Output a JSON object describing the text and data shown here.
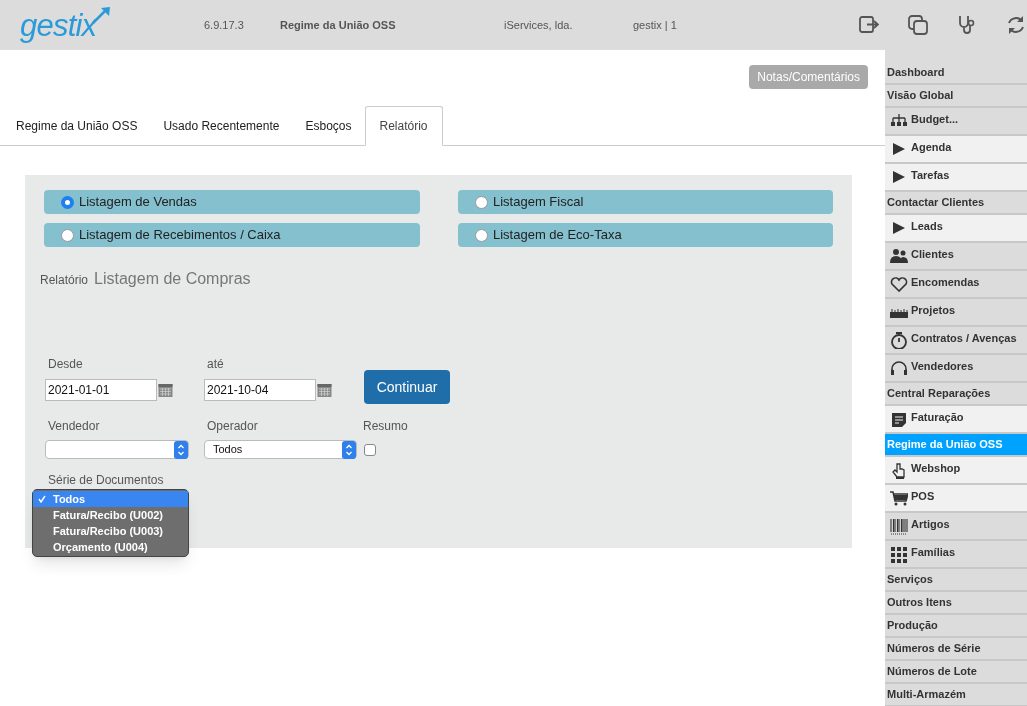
{
  "header": {
    "logo": "gestix",
    "version": "6.9.17.3",
    "module": "Regime da União OSS",
    "company": "iServices, lda.",
    "user": "gestix | 1"
  },
  "notes_button": "Notas/Comentários",
  "tabs": [
    {
      "label": "Regime da União OSS",
      "selected": false
    },
    {
      "label": "Usado Recentemente",
      "selected": false
    },
    {
      "label": "Esboços",
      "selected": false
    },
    {
      "label": "Relatório",
      "selected": true
    }
  ],
  "report_types": [
    {
      "label": "Listagem de Vendas",
      "selected": true
    },
    {
      "label": "Listagem Fiscal",
      "selected": false
    },
    {
      "label": "Listagem de Recebimentos / Caixa",
      "selected": false
    },
    {
      "label": "Listagem de Eco-Taxa",
      "selected": false
    }
  ],
  "report": {
    "label": "Relatório",
    "title": "Listagem de Compras"
  },
  "form": {
    "from_label": "Desde",
    "from_value": "2021-01-01",
    "to_label": "até",
    "to_value": "2021-10-04",
    "continue_button": "Continuar",
    "seller_label": "Vendedor",
    "operator_label": "Operador",
    "operator_value": "Todos",
    "summary_label": "Resumo",
    "summary_checked": false,
    "series_label": "Série de Documentos",
    "series_options": [
      {
        "label": "Todos",
        "selected": true
      },
      {
        "label": "Fatura/Recibo (U002)",
        "selected": false
      },
      {
        "label": "Fatura/Recibo (U003)",
        "selected": false
      },
      {
        "label": "Orçamento (U004)",
        "selected": false
      }
    ]
  },
  "sidebar": {
    "items": [
      {
        "label": "Dashboard",
        "kind": "text",
        "highlighted": false,
        "selected": false
      },
      {
        "label": "Visão Global",
        "kind": "text",
        "highlighted": false,
        "selected": false
      },
      {
        "label": "Budget...",
        "kind": "org",
        "highlighted": false,
        "selected": false
      },
      {
        "label": "Agenda",
        "kind": "play",
        "highlighted": true,
        "selected": false
      },
      {
        "label": "Tarefas",
        "kind": "play",
        "highlighted": true,
        "selected": false
      },
      {
        "label": "Contactar Clientes",
        "kind": "text",
        "highlighted": false,
        "selected": false
      },
      {
        "label": "Leads",
        "kind": "play",
        "highlighted": true,
        "selected": false
      },
      {
        "label": "Clientes",
        "kind": "people",
        "highlighted": false,
        "selected": false
      },
      {
        "label": "Encomendas",
        "kind": "heart",
        "highlighted": false,
        "selected": false
      },
      {
        "label": "Projetos",
        "kind": "ruler",
        "highlighted": false,
        "selected": false
      },
      {
        "label": "Contratos / Avenças",
        "kind": "timer",
        "highlighted": false,
        "selected": false
      },
      {
        "label": "Vendedores",
        "kind": "headset",
        "highlighted": false,
        "selected": false
      },
      {
        "label": "Central Reparações",
        "kind": "text",
        "highlighted": false,
        "selected": false
      },
      {
        "label": "Faturação",
        "kind": "note",
        "highlighted": true,
        "selected": false
      },
      {
        "label": "Regime da União OSS",
        "kind": "text",
        "selected": true
      },
      {
        "label": "Webshop",
        "kind": "hand",
        "highlighted": true,
        "selected": false
      },
      {
        "label": "POS",
        "kind": "cart",
        "highlighted": true,
        "selected": false
      },
      {
        "label": "Artigos",
        "kind": "barcode",
        "highlighted": false,
        "selected": false
      },
      {
        "label": "Famílias",
        "kind": "grid",
        "highlighted": false,
        "selected": false
      },
      {
        "label": "Serviços",
        "kind": "text",
        "highlighted": false,
        "selected": false
      },
      {
        "label": "Outros Itens",
        "kind": "text",
        "highlighted": false,
        "selected": false
      },
      {
        "label": "Produção",
        "kind": "text",
        "highlighted": false,
        "selected": false
      },
      {
        "label": "Números de Série",
        "kind": "text",
        "highlighted": false,
        "selected": false
      },
      {
        "label": "Números de Lote",
        "kind": "text",
        "highlighted": false,
        "selected": false
      },
      {
        "label": "Multi-Armazém",
        "kind": "text",
        "highlighted": false,
        "selected": false
      }
    ]
  }
}
